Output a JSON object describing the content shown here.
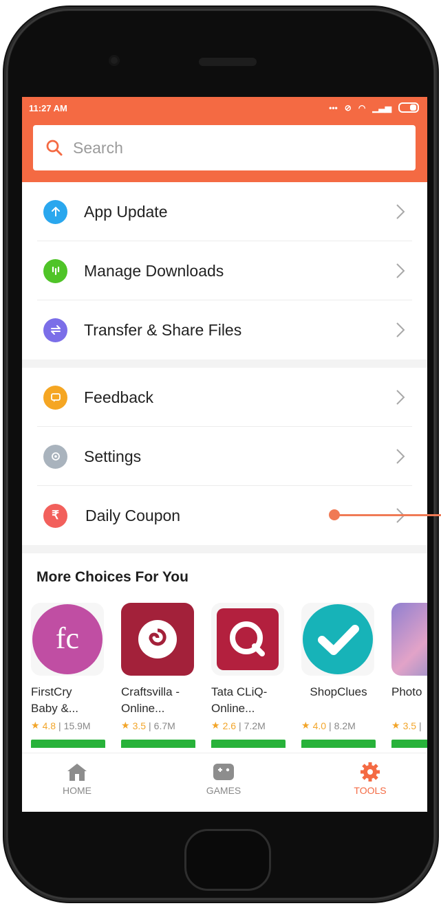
{
  "status_bar": {
    "time": "11:27 AM"
  },
  "search": {
    "placeholder": "Search"
  },
  "menu": {
    "group1": [
      {
        "label": "App Update",
        "icon": "arrow-up-icon",
        "color": "#2aa7ee"
      },
      {
        "label": "Manage Downloads",
        "icon": "download-icon",
        "color": "#4fc428"
      },
      {
        "label": "Transfer & Share Files",
        "icon": "transfer-icon",
        "color": "#7b6ee8"
      }
    ],
    "group2": [
      {
        "label": "Feedback",
        "icon": "feedback-icon",
        "color": "#f5a623"
      },
      {
        "label": "Settings",
        "icon": "gear-icon",
        "color": "#a9b3bd"
      },
      {
        "label": "Daily Coupon",
        "icon": "rupee-icon",
        "color": "#f2605c"
      }
    ]
  },
  "more_choices": {
    "title": "More Choices For You",
    "apps": [
      {
        "name_line1": "FirstCry",
        "name_line2": "Baby &...",
        "rating": "4.8",
        "size": "15.9M",
        "icon_color": "#c04ea3"
      },
      {
        "name_line1": "Craftsvilla -",
        "name_line2": "Online...",
        "rating": "3.5",
        "size": "6.7M",
        "icon_color": "#a3213a"
      },
      {
        "name_line1": "Tata CLiQ-",
        "name_line2": "Online...",
        "rating": "2.6",
        "size": "7.2M",
        "icon_color": "#b3203e"
      },
      {
        "name_line1": "ShopClues",
        "name_line2": "",
        "rating": "4.0",
        "size": "8.2M",
        "icon_color": "#17b3b8"
      },
      {
        "name_line1": "Photo",
        "name_line2": "",
        "rating": "3.5",
        "size": "",
        "icon_color": "#6e86c8"
      }
    ]
  },
  "bottom_nav": {
    "home": "HOME",
    "games": "GAMES",
    "tools": "TOOLS",
    "active_color": "#f46a43"
  },
  "colors": {
    "accent": "#f46a43",
    "install_green": "#28b23a"
  }
}
